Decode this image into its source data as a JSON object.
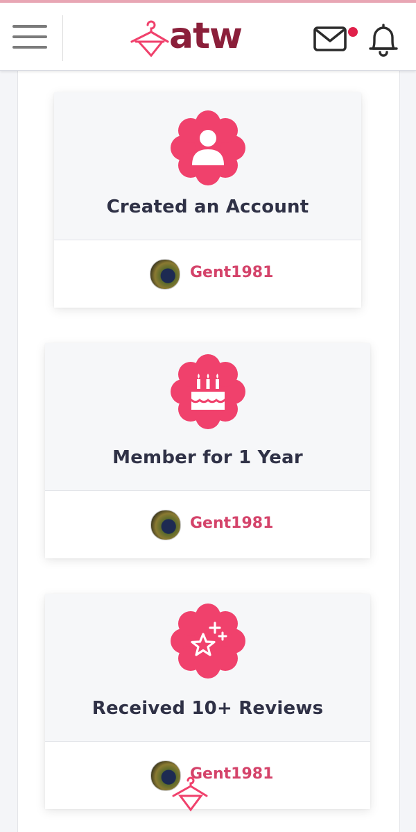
{
  "header": {
    "logo_text": "atw",
    "icons": [
      "menu-icon",
      "hanger-logo-icon",
      "mail-icon",
      "notification-dot",
      "bell-icon"
    ]
  },
  "colors": {
    "accent": "#f0416c",
    "brand_text": "#8b1f3a",
    "username": "#d4436a",
    "title": "#2f3146"
  },
  "achievements": [
    {
      "title": "Created an Account",
      "icon": "user-icon",
      "username": "Gent1981"
    },
    {
      "title": "Member for 1 Year",
      "icon": "birthday-cake-icon",
      "username": "Gent1981"
    },
    {
      "title": "Received 10+ Reviews",
      "icon": "sparkle-star-icon",
      "username": "Gent1981"
    }
  ]
}
